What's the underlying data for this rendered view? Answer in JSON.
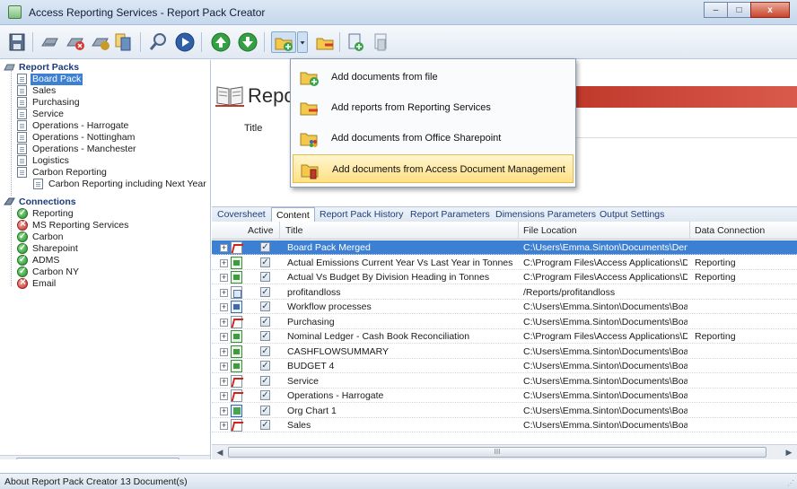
{
  "window": {
    "title": "Access Reporting Services - Report Pack Creator",
    "minimize": "–",
    "maximize": "□",
    "close": "x"
  },
  "toolbar": {
    "icons": [
      "save-icon",
      "open-pack-icon",
      "delete-pack-icon",
      "copy-pack-icon",
      "pack-properties-icon",
      "search-icon",
      "run-icon",
      "move-up-icon",
      "move-down-icon",
      "add-document-icon",
      "dropdown-arrow-icon",
      "add-report-icon",
      "export-icon",
      "remove-icon"
    ]
  },
  "tree": {
    "report_packs_label": "Report Packs",
    "packs": [
      "Board Pack",
      "Sales",
      "Purchasing",
      "Service",
      "Operations - Harrogate",
      "Operations - Nottingham",
      "Operations - Manchester",
      "Logistics",
      "Carbon Reporting",
      "Carbon Reporting including Next Year"
    ],
    "connections_label": "Connections",
    "connections": [
      {
        "label": "Reporting",
        "status": "ok"
      },
      {
        "label": "MS Reporting Services",
        "status": "error"
      },
      {
        "label": "Carbon",
        "status": "ok"
      },
      {
        "label": "Sharepoint",
        "status": "ok"
      },
      {
        "label": "ADMS",
        "status": "ok"
      },
      {
        "label": "Carbon NY",
        "status": "ok"
      },
      {
        "label": "Email",
        "status": "error"
      }
    ]
  },
  "header": {
    "title": "Repor",
    "title_field_label": "Title"
  },
  "menu": {
    "items": [
      "Add documents from file",
      "Add reports from Reporting Services",
      "Add documents from Office Sharepoint",
      "Add documents from Access Document Management"
    ]
  },
  "tabs": [
    "Coversheet",
    "Content",
    "Report Pack History",
    "Report Parameters",
    "Dimensions Parameters",
    "Output Settings"
  ],
  "grid": {
    "columns": [
      "Active",
      "Title",
      "File Location",
      "Data Connection"
    ],
    "rows": [
      {
        "type": "pdf",
        "active": true,
        "title": "Board Pack Merged",
        "location": "C:\\Users\\Emma.Sinton\\Documents\\Dem...",
        "connection": ""
      },
      {
        "type": "xls",
        "active": true,
        "title": "Actual Emissions Current Year Vs Last Year in Tonnes",
        "location": "C:\\Program Files\\Access Applications\\Di...",
        "connection": "Reporting"
      },
      {
        "type": "xls",
        "active": true,
        "title": "Actual Vs Budget By Division Heading in Tonnes",
        "location": "C:\\Program Files\\Access Applications\\Di...",
        "connection": "Reporting"
      },
      {
        "type": "rpt",
        "active": true,
        "title": "profitandloss",
        "location": "/Reports/profitandloss",
        "connection": ""
      },
      {
        "type": "doc",
        "active": true,
        "title": "Workflow processes",
        "location": "C:\\Users\\Emma.Sinton\\Documents\\Boar...",
        "connection": ""
      },
      {
        "type": "pdf",
        "active": true,
        "title": "Purchasing",
        "location": "C:\\Users\\Emma.Sinton\\Documents\\Boar...",
        "connection": ""
      },
      {
        "type": "xls",
        "active": true,
        "title": "Nominal Ledger - Cash Book Reconciliation",
        "location": "C:\\Program Files\\Access Applications\\Di...",
        "connection": "Reporting"
      },
      {
        "type": "xls",
        "active": true,
        "title": "CASHFLOWSUMMARY",
        "location": "C:\\Users\\Emma.Sinton\\Documents\\Boar...",
        "connection": ""
      },
      {
        "type": "xls",
        "active": true,
        "title": "BUDGET 4",
        "location": "C:\\Users\\Emma.Sinton\\Documents\\Boar...",
        "connection": ""
      },
      {
        "type": "pdf",
        "active": true,
        "title": "Service",
        "location": "C:\\Users\\Emma.Sinton\\Documents\\Boar...",
        "connection": ""
      },
      {
        "type": "pdf",
        "active": true,
        "title": "Operations - Harrogate",
        "location": "C:\\Users\\Emma.Sinton\\Documents\\Boar...",
        "connection": ""
      },
      {
        "type": "vsd",
        "active": true,
        "title": "Org Chart 1",
        "location": "C:\\Users\\Emma.Sinton\\Documents\\Boar...",
        "connection": ""
      },
      {
        "type": "pdf",
        "active": true,
        "title": "Sales",
        "location": "C:\\Users\\Emma.Sinton\\Documents\\Boar...",
        "connection": ""
      }
    ]
  },
  "scrollbars": {
    "thumb_grip": "III"
  },
  "statusbar": {
    "text": "About Report Pack Creator  13 Document(s)"
  },
  "colors": {
    "selection": "#3d7fd2",
    "header_accent": "#c0392b",
    "menu_highlight": "#ffe083"
  }
}
